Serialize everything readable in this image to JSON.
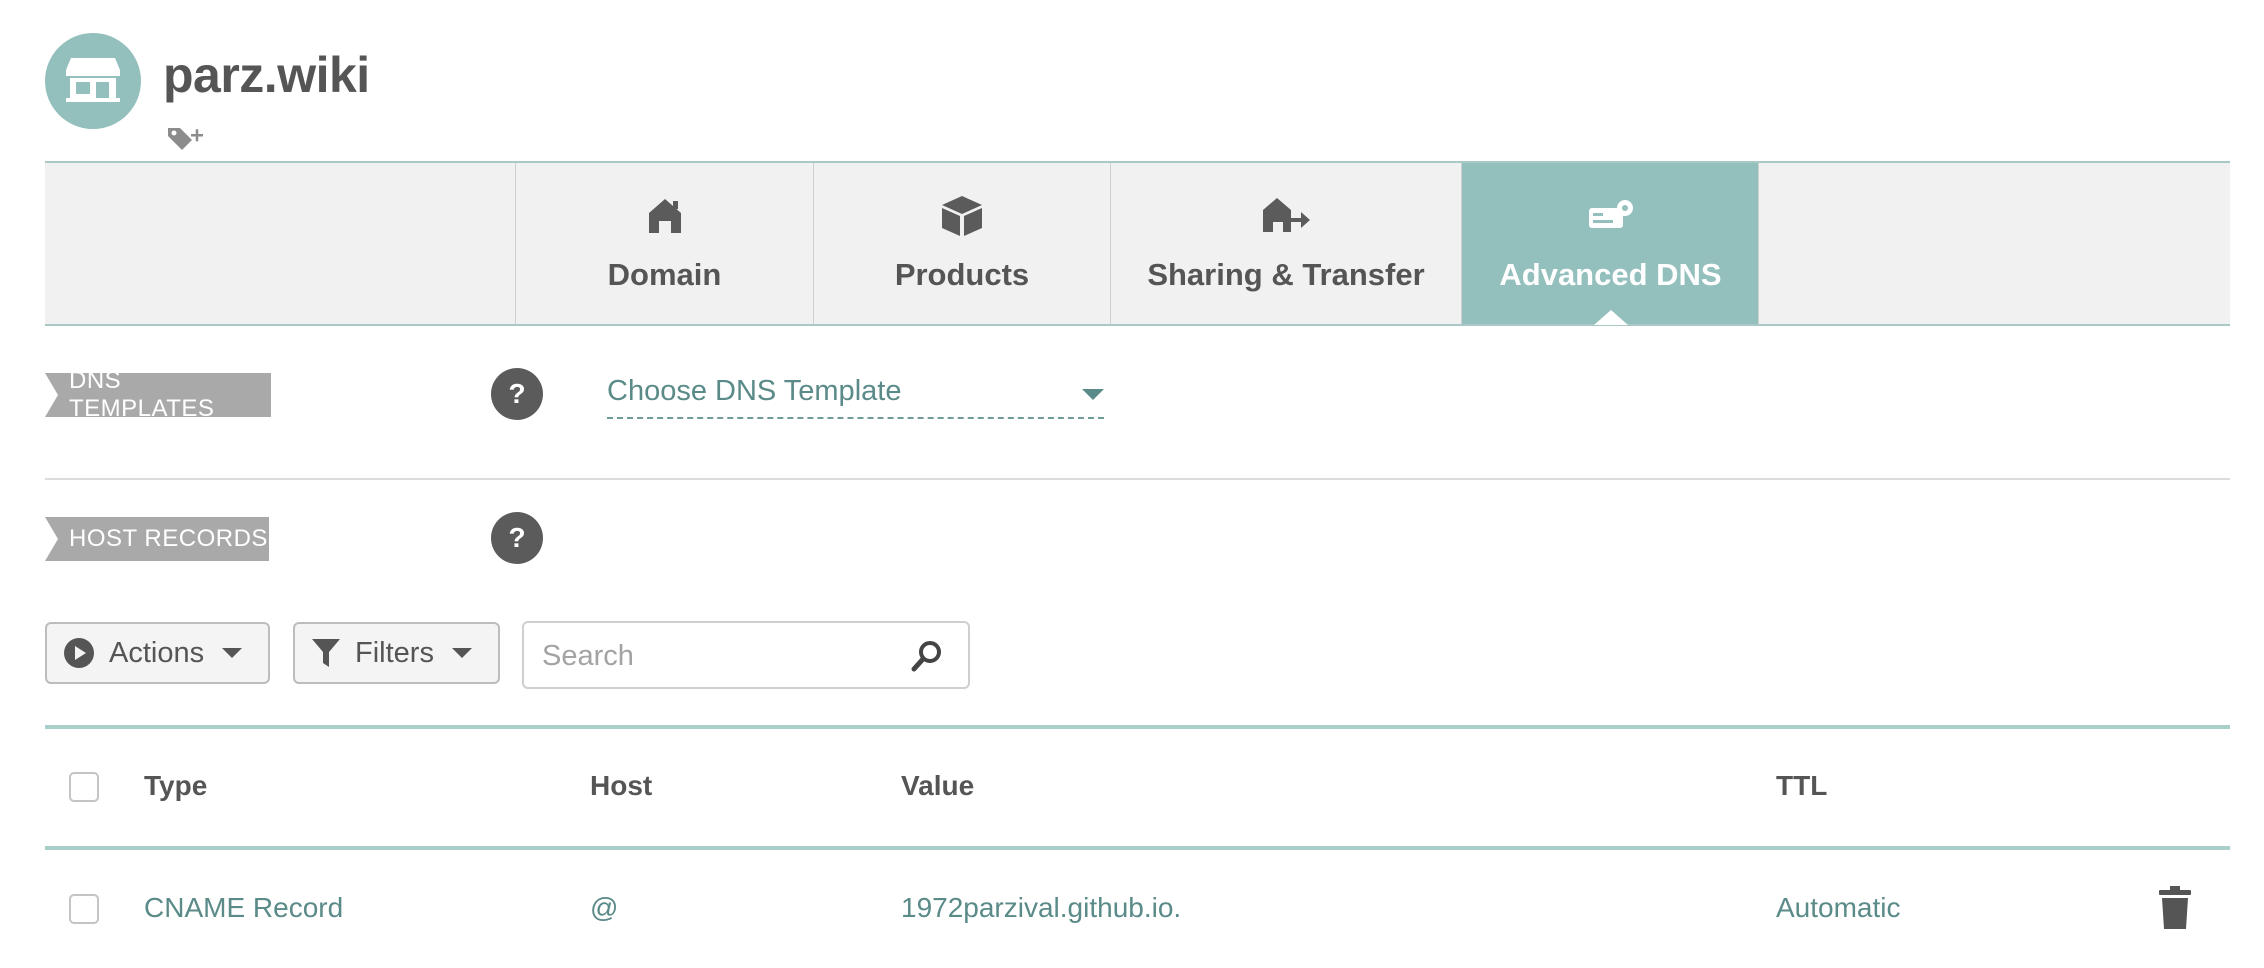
{
  "header": {
    "domain_name": "parz.wiki",
    "avatar_icon": "storefront-icon",
    "tag_add_icon": "tag-add-icon"
  },
  "tabs": [
    {
      "label": "Domain",
      "icon": "house-icon",
      "active": false
    },
    {
      "label": "Products",
      "icon": "box-icon",
      "active": false
    },
    {
      "label": "Sharing & Transfer",
      "icon": "house-transfer-icon",
      "active": false
    },
    {
      "label": "Advanced DNS",
      "icon": "router-icon",
      "active": true
    }
  ],
  "dns_templates": {
    "label": "DNS TEMPLATES",
    "help": "?",
    "select_value": "Choose DNS Template"
  },
  "host_records": {
    "label": "HOST RECORDS",
    "help": "?"
  },
  "toolbar": {
    "actions_label": "Actions",
    "filters_label": "Filters",
    "search_placeholder": "Search"
  },
  "table": {
    "columns": [
      "Type",
      "Host",
      "Value",
      "TTL"
    ],
    "rows": [
      {
        "type": "CNAME Record",
        "host": "@",
        "value": "1972parzival.github.io.",
        "ttl": "Automatic"
      }
    ]
  },
  "colors": {
    "accent": "#93bfbc",
    "link": "#5a8b88",
    "label_bg": "#a9a9a9"
  }
}
